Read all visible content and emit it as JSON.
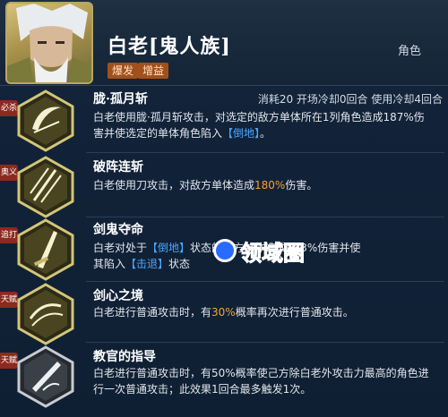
{
  "character": {
    "name": "白老[鬼人族]",
    "role": "角色",
    "tags": [
      "爆发",
      "增益"
    ]
  },
  "skills": [
    {
      "side_label": "必杀",
      "title": "胧·孤月斩",
      "cost": "消耗20  开场冷却0回合  使用冷却4回合",
      "desc_parts": [
        "白老使用胧·孤月斩攻击，对选定的敌方单体所在1列角色造成187%伤害并使选定的单体角色陷入",
        "【倒地】",
        "。"
      ]
    },
    {
      "side_label": "奥义",
      "title": "破阵连斩",
      "desc_parts": [
        "白老使用刀攻击，对敌方单体造成",
        "180%",
        "伤害。"
      ]
    },
    {
      "side_label": "追打",
      "title": "剑鬼夺命",
      "desc_parts": [
        "白老对处于",
        "【倒地】",
        "状态的敌方单体造成113%伤害并使其陷入",
        "【击退】",
        "状态"
      ]
    },
    {
      "side_label": "天赋",
      "title": "剑心之境",
      "desc_parts": [
        "白老进行普通攻击时，有",
        "30%",
        "概率再次进行普通攻击。"
      ]
    },
    {
      "side_label": "天赋",
      "title": "教官的指导",
      "desc_parts": [
        "白老进行普通攻击时，有50%概率使己方除白老外攻击力最高的角色进行一次普通攻击；此效果1回合最多触发1次。"
      ]
    }
  ],
  "watermark": {
    "text": "领域圈"
  },
  "icons": [
    "crescent-slash-icon",
    "blade-strike-icon",
    "sword-icon",
    "swirl-icon",
    "mentor-icon"
  ]
}
